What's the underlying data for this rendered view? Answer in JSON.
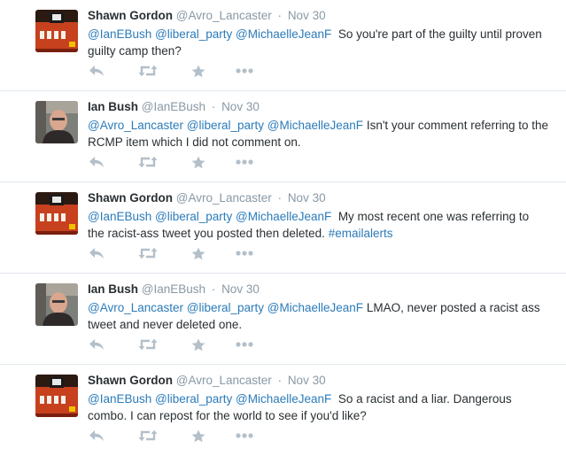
{
  "colors": {
    "text": "#292f33",
    "muted": "#8899a6",
    "link": "#2b7bb9",
    "action_icon": "#b3bfc9",
    "divider": "#e1e8ed"
  },
  "icons": {
    "reply": "reply-icon",
    "retweet": "retweet-icon",
    "favorite": "star-icon",
    "more": "more-icon"
  },
  "tweets": [
    {
      "fullname": "Shawn Gordon",
      "username": "@Avro_Lancaster",
      "sep": "·",
      "time": "Nov 30",
      "avatar": "orange-logo",
      "mentions": [
        "@IanEBush",
        "@liberal_party",
        "@MichaelleJeanF"
      ],
      "body": "So you're part of the guilty until proven guilty camp then?"
    },
    {
      "fullname": "Ian Bush",
      "username": "@IanEBush",
      "sep": "·",
      "time": "Nov 30",
      "avatar": "person-photo",
      "mentions": [
        "@Avro_Lancaster",
        "@liberal_party",
        "@MichaelleJeanF"
      ],
      "body": "Isn't your comment referring to the RCMP item which I did not comment on."
    },
    {
      "fullname": "Shawn Gordon",
      "username": "@Avro_Lancaster",
      "sep": "·",
      "time": "Nov 30",
      "avatar": "orange-logo",
      "mentions": [
        "@IanEBush",
        "@liberal_party",
        "@MichaelleJeanF"
      ],
      "body": "My most recent one was referring to the racist-ass tweet you posted then deleted.",
      "hashtag": "#emailalerts"
    },
    {
      "fullname": "Ian Bush",
      "username": "@IanEBush",
      "sep": "·",
      "time": "Nov 30",
      "avatar": "person-photo",
      "mentions": [
        "@Avro_Lancaster",
        "@liberal_party",
        "@MichaelleJeanF"
      ],
      "body": "LMAO, never posted a racist ass tweet and never deleted one."
    },
    {
      "fullname": "Shawn Gordon",
      "username": "@Avro_Lancaster",
      "sep": "·",
      "time": "Nov 30",
      "avatar": "orange-logo",
      "mentions": [
        "@IanEBush",
        "@liberal_party",
        "@MichaelleJeanF"
      ],
      "body": "So a racist and a liar. Dangerous combo. I can repost for the world to see if you'd like?"
    }
  ]
}
